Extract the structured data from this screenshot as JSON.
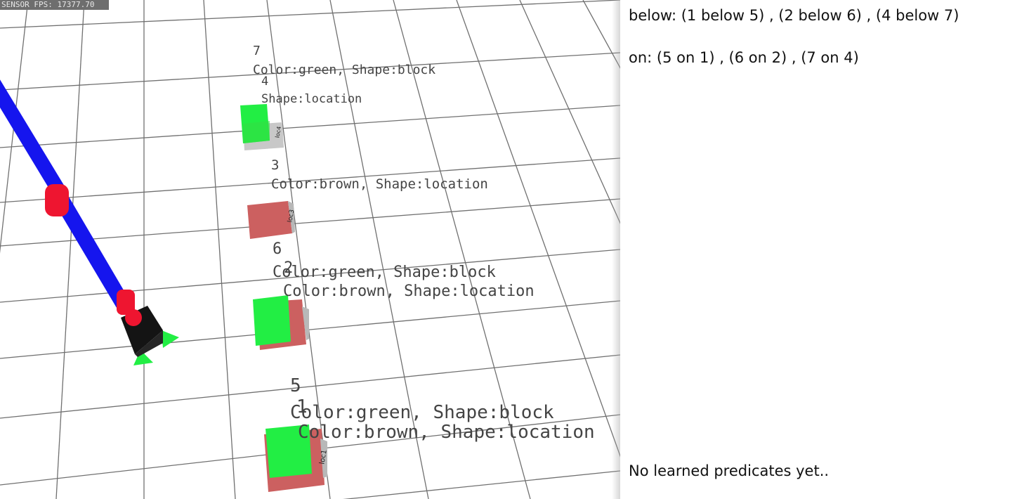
{
  "viewport": {
    "fps_text": "SENSOR FPS: 17377.70",
    "objects": [
      {
        "id": "7",
        "desc": "Color:green, Shape:block"
      },
      {
        "id": "4",
        "desc": "Shape:location",
        "tag": "loc4"
      },
      {
        "id": "3",
        "desc": "Color:brown, Shape:location",
        "tag": "loc3"
      },
      {
        "id": "6",
        "desc": "Color:green, Shape:block"
      },
      {
        "id": "2",
        "desc": "Color:brown, Shape:location",
        "tag": "loc2"
      },
      {
        "id": "5",
        "desc": "Color:green, Shape:block"
      },
      {
        "id": "1",
        "desc": "Color:brown, Shape:location",
        "tag": "loc1"
      }
    ],
    "colors": {
      "block": "#22ee44",
      "location": "#cc6060",
      "arm": "#1515ee",
      "joint": "#ee1530",
      "gripper": "#141414",
      "grid": "#707070"
    }
  },
  "panel": {
    "below_line": "below: (1 below 5) , (2 below 6) , (4 below 7)",
    "on_line": "on: (5 on 1) , (6 on 2) , (7 on 4)",
    "status": "No learned predicates yet.."
  }
}
